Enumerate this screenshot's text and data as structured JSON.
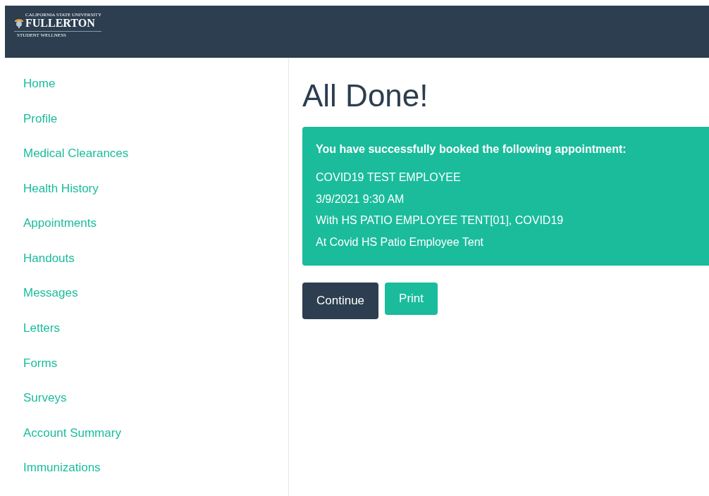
{
  "header": {
    "logo": {
      "top": "CALIFORNIA STATE UNIVERSITY",
      "name": "FULLERTON",
      "sub": "STUDENT WELLNESS"
    }
  },
  "sidebar": {
    "items": [
      "Home",
      "Profile",
      "Medical Clearances",
      "Health History",
      "Appointments",
      "Handouts",
      "Messages",
      "Letters",
      "Forms",
      "Surveys",
      "Account Summary",
      "Immunizations"
    ]
  },
  "main": {
    "title": "All Done!",
    "alert": {
      "heading": "You have successfully booked the following appointment:",
      "lines": [
        "COVID19 TEST EMPLOYEE",
        "3/9/2021 9:30 AM",
        "With HS PATIO EMPLOYEE TENT[01], COVID19",
        "At Covid HS Patio Employee Tent"
      ]
    },
    "buttons": [
      {
        "label": "Continue",
        "kind": "dark"
      },
      {
        "label": "Print",
        "kind": "accent"
      }
    ]
  }
}
